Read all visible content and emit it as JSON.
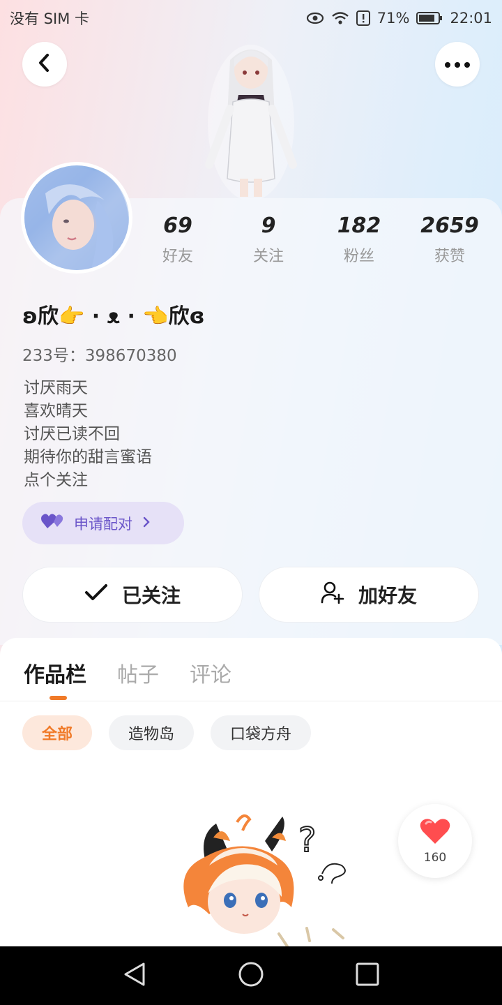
{
  "status_bar": {
    "carrier": "没有 SIM 卡",
    "battery": "71%",
    "time": "22:01"
  },
  "profile": {
    "stats": [
      {
        "value": "69",
        "label": "好友"
      },
      {
        "value": "9",
        "label": "关注"
      },
      {
        "value": "182",
        "label": "粉丝"
      },
      {
        "value": "2659",
        "label": "获赞"
      }
    ],
    "nickname": "ʚ欣👉 · ᴥ · 👈欣ɞ",
    "id_label": "233号：",
    "id_value": "398670380",
    "bio": [
      "讨厌雨天",
      "喜欢晴天",
      "讨厌已读不回",
      "期待你的甜言蜜语",
      "点个关注"
    ],
    "pair_button": "申请配对",
    "followed_button": "已关注",
    "add_friend_button": "加好友"
  },
  "tabs": [
    {
      "label": "作品栏",
      "active": true
    },
    {
      "label": "帖子",
      "active": false
    },
    {
      "label": "评论",
      "active": false
    }
  ],
  "chips": [
    {
      "label": "全部",
      "active": true
    },
    {
      "label": "造物岛",
      "active": false
    },
    {
      "label": "口袋方舟",
      "active": false
    }
  ],
  "like_bubble": {
    "count": "160"
  },
  "colors": {
    "accent_orange": "#f07a28",
    "pair_purple": "#6a55c9",
    "like_red": "#ff4d4f"
  },
  "icons": {
    "back": "chevron-left-icon",
    "more": "more-dots-icon",
    "check": "check-icon",
    "add_user": "add-user-icon",
    "heart": "heart-icon",
    "pair": "double-heart-icon"
  }
}
